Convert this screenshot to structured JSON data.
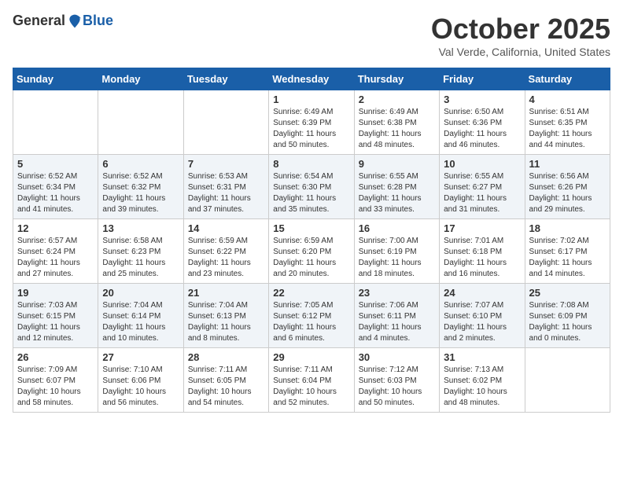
{
  "header": {
    "logo_general": "General",
    "logo_blue": "Blue",
    "month": "October 2025",
    "location": "Val Verde, California, United States"
  },
  "days_of_week": [
    "Sunday",
    "Monday",
    "Tuesday",
    "Wednesday",
    "Thursday",
    "Friday",
    "Saturday"
  ],
  "weeks": [
    [
      {
        "day": "",
        "info": ""
      },
      {
        "day": "",
        "info": ""
      },
      {
        "day": "",
        "info": ""
      },
      {
        "day": "1",
        "info": "Sunrise: 6:49 AM\nSunset: 6:39 PM\nDaylight: 11 hours\nand 50 minutes."
      },
      {
        "day": "2",
        "info": "Sunrise: 6:49 AM\nSunset: 6:38 PM\nDaylight: 11 hours\nand 48 minutes."
      },
      {
        "day": "3",
        "info": "Sunrise: 6:50 AM\nSunset: 6:36 PM\nDaylight: 11 hours\nand 46 minutes."
      },
      {
        "day": "4",
        "info": "Sunrise: 6:51 AM\nSunset: 6:35 PM\nDaylight: 11 hours\nand 44 minutes."
      }
    ],
    [
      {
        "day": "5",
        "info": "Sunrise: 6:52 AM\nSunset: 6:34 PM\nDaylight: 11 hours\nand 41 minutes."
      },
      {
        "day": "6",
        "info": "Sunrise: 6:52 AM\nSunset: 6:32 PM\nDaylight: 11 hours\nand 39 minutes."
      },
      {
        "day": "7",
        "info": "Sunrise: 6:53 AM\nSunset: 6:31 PM\nDaylight: 11 hours\nand 37 minutes."
      },
      {
        "day": "8",
        "info": "Sunrise: 6:54 AM\nSunset: 6:30 PM\nDaylight: 11 hours\nand 35 minutes."
      },
      {
        "day": "9",
        "info": "Sunrise: 6:55 AM\nSunset: 6:28 PM\nDaylight: 11 hours\nand 33 minutes."
      },
      {
        "day": "10",
        "info": "Sunrise: 6:55 AM\nSunset: 6:27 PM\nDaylight: 11 hours\nand 31 minutes."
      },
      {
        "day": "11",
        "info": "Sunrise: 6:56 AM\nSunset: 6:26 PM\nDaylight: 11 hours\nand 29 minutes."
      }
    ],
    [
      {
        "day": "12",
        "info": "Sunrise: 6:57 AM\nSunset: 6:24 PM\nDaylight: 11 hours\nand 27 minutes."
      },
      {
        "day": "13",
        "info": "Sunrise: 6:58 AM\nSunset: 6:23 PM\nDaylight: 11 hours\nand 25 minutes."
      },
      {
        "day": "14",
        "info": "Sunrise: 6:59 AM\nSunset: 6:22 PM\nDaylight: 11 hours\nand 23 minutes."
      },
      {
        "day": "15",
        "info": "Sunrise: 6:59 AM\nSunset: 6:20 PM\nDaylight: 11 hours\nand 20 minutes."
      },
      {
        "day": "16",
        "info": "Sunrise: 7:00 AM\nSunset: 6:19 PM\nDaylight: 11 hours\nand 18 minutes."
      },
      {
        "day": "17",
        "info": "Sunrise: 7:01 AM\nSunset: 6:18 PM\nDaylight: 11 hours\nand 16 minutes."
      },
      {
        "day": "18",
        "info": "Sunrise: 7:02 AM\nSunset: 6:17 PM\nDaylight: 11 hours\nand 14 minutes."
      }
    ],
    [
      {
        "day": "19",
        "info": "Sunrise: 7:03 AM\nSunset: 6:15 PM\nDaylight: 11 hours\nand 12 minutes."
      },
      {
        "day": "20",
        "info": "Sunrise: 7:04 AM\nSunset: 6:14 PM\nDaylight: 11 hours\nand 10 minutes."
      },
      {
        "day": "21",
        "info": "Sunrise: 7:04 AM\nSunset: 6:13 PM\nDaylight: 11 hours\nand 8 minutes."
      },
      {
        "day": "22",
        "info": "Sunrise: 7:05 AM\nSunset: 6:12 PM\nDaylight: 11 hours\nand 6 minutes."
      },
      {
        "day": "23",
        "info": "Sunrise: 7:06 AM\nSunset: 6:11 PM\nDaylight: 11 hours\nand 4 minutes."
      },
      {
        "day": "24",
        "info": "Sunrise: 7:07 AM\nSunset: 6:10 PM\nDaylight: 11 hours\nand 2 minutes."
      },
      {
        "day": "25",
        "info": "Sunrise: 7:08 AM\nSunset: 6:09 PM\nDaylight: 11 hours\nand 0 minutes."
      }
    ],
    [
      {
        "day": "26",
        "info": "Sunrise: 7:09 AM\nSunset: 6:07 PM\nDaylight: 10 hours\nand 58 minutes."
      },
      {
        "day": "27",
        "info": "Sunrise: 7:10 AM\nSunset: 6:06 PM\nDaylight: 10 hours\nand 56 minutes."
      },
      {
        "day": "28",
        "info": "Sunrise: 7:11 AM\nSunset: 6:05 PM\nDaylight: 10 hours\nand 54 minutes."
      },
      {
        "day": "29",
        "info": "Sunrise: 7:11 AM\nSunset: 6:04 PM\nDaylight: 10 hours\nand 52 minutes."
      },
      {
        "day": "30",
        "info": "Sunrise: 7:12 AM\nSunset: 6:03 PM\nDaylight: 10 hours\nand 50 minutes."
      },
      {
        "day": "31",
        "info": "Sunrise: 7:13 AM\nSunset: 6:02 PM\nDaylight: 10 hours\nand 48 minutes."
      },
      {
        "day": "",
        "info": ""
      }
    ]
  ]
}
